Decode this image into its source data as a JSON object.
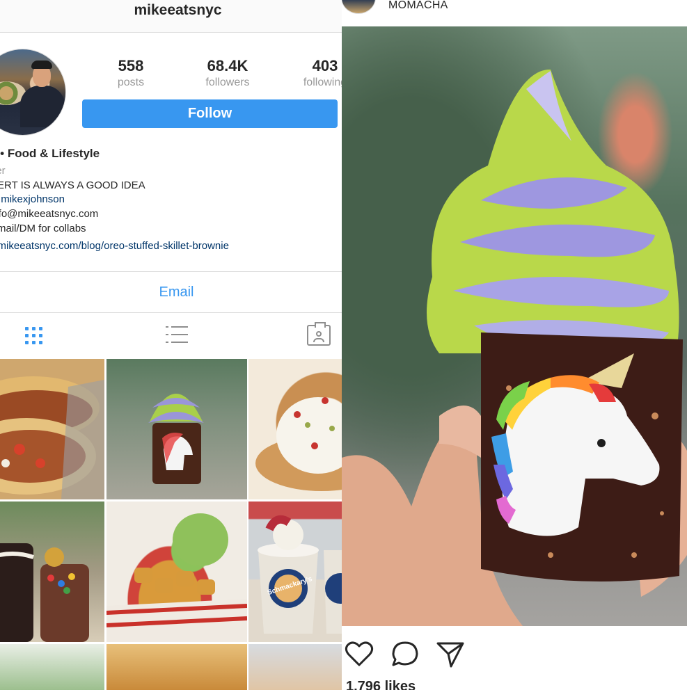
{
  "profile": {
    "username": "mikeeatsnyc",
    "stats": [
      {
        "value": "558",
        "label": "posts"
      },
      {
        "value": "68.4K",
        "label": "followers"
      },
      {
        "value": "403",
        "label": "following"
      }
    ],
    "follow_label": "Follow",
    "bio": {
      "name": "e • Food & Lifestyle",
      "category": "ger",
      "line1": "SERT IS ALWAYS A GOOD IDEA",
      "mention": "@mikexjohnson",
      "contact": "info@mikeeatsnyc.com",
      "collab": "Email/DM for collabs",
      "link": "v.mikeeatsnyc.com/blog/oreo-stuffed-skillet-brownie"
    },
    "email_label": "Email",
    "tabs": [
      "grid-icon",
      "list-icon",
      "tagged-icon"
    ],
    "grid_cups_text": "Schmackary's"
  },
  "post": {
    "location": "MOMACHA",
    "actions": [
      "heart-icon",
      "comment-icon",
      "share-icon"
    ],
    "likes": "1,796 likes"
  },
  "colors": {
    "accent": "#3897f0",
    "link": "#003569",
    "muted": "#999999",
    "text": "#262626"
  }
}
